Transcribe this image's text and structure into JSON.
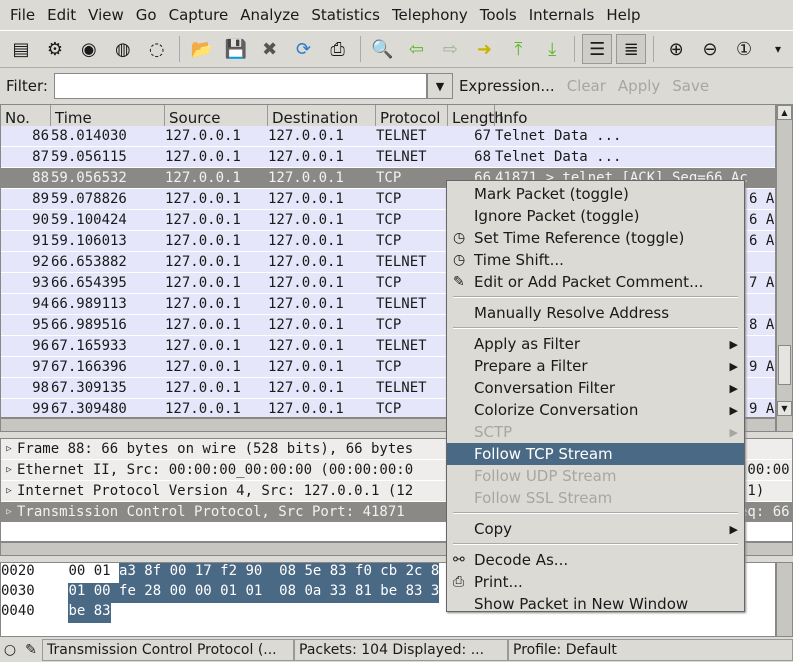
{
  "menubar": [
    "File",
    "Edit",
    "View",
    "Go",
    "Capture",
    "Analyze",
    "Statistics",
    "Telephony",
    "Tools",
    "Internals",
    "Help"
  ],
  "toolbar": [
    "interface-list-icon",
    "capture-options-icon",
    "start-capture-icon",
    "stop-capture-icon",
    "restart-capture-icon",
    "open-icon",
    "save-icon",
    "close-icon",
    "reload-icon",
    "print-icon",
    "find-icon",
    "back-icon",
    "forward-icon",
    "go-to-packet-icon",
    "first-packet-icon",
    "last-packet-icon",
    "colorize-icon",
    "auto-scroll-icon",
    "zoom-in-icon",
    "zoom-out-icon",
    "normal-size-icon",
    "more-icon"
  ],
  "filter": {
    "label": "Filter:",
    "value": "",
    "expression": "Expression...",
    "clear": "Clear",
    "apply": "Apply",
    "save": "Save"
  },
  "columns": [
    "No.",
    "Time",
    "Source",
    "Destination",
    "Protocol",
    "Length",
    "Info"
  ],
  "packets": [
    {
      "no": "86",
      "time": "58.014030",
      "src": "127.0.0.1",
      "dst": "127.0.0.1",
      "proto": "TELNET",
      "len": "67",
      "info": "Telnet Data ..."
    },
    {
      "no": "87",
      "time": "59.056115",
      "src": "127.0.0.1",
      "dst": "127.0.0.1",
      "proto": "TELNET",
      "len": "68",
      "info": "Telnet Data ..."
    },
    {
      "no": "88",
      "time": "59.056532",
      "src": "127.0.0.1",
      "dst": "127.0.0.1",
      "proto": "TCP",
      "len": "66",
      "info": "41871 > telnet [ACK] Seq=66 Ac",
      "selected": true
    },
    {
      "no": "89",
      "time": "59.078826",
      "src": "127.0.0.1",
      "dst": "127.0.0.1",
      "proto": "TCP",
      "tail": "6 Ac"
    },
    {
      "no": "90",
      "time": "59.100424",
      "src": "127.0.0.1",
      "dst": "127.0.0.1",
      "proto": "TCP",
      "tail": "6 Ac"
    },
    {
      "no": "91",
      "time": "59.106013",
      "src": "127.0.0.1",
      "dst": "127.0.0.1",
      "proto": "TCP",
      "tail": "6 Ac"
    },
    {
      "no": "92",
      "time": "66.653882",
      "src": "127.0.0.1",
      "dst": "127.0.0.1",
      "proto": "TELNET",
      "tail": ""
    },
    {
      "no": "93",
      "time": "66.654395",
      "src": "127.0.0.1",
      "dst": "127.0.0.1",
      "proto": "TCP",
      "tail": "7 Ac"
    },
    {
      "no": "94",
      "time": "66.989113",
      "src": "127.0.0.1",
      "dst": "127.0.0.1",
      "proto": "TELNET",
      "tail": ""
    },
    {
      "no": "95",
      "time": "66.989516",
      "src": "127.0.0.1",
      "dst": "127.0.0.1",
      "proto": "TCP",
      "tail": "8 Ac"
    },
    {
      "no": "96",
      "time": "67.165933",
      "src": "127.0.0.1",
      "dst": "127.0.0.1",
      "proto": "TELNET",
      "tail": ""
    },
    {
      "no": "97",
      "time": "67.166396",
      "src": "127.0.0.1",
      "dst": "127.0.0.1",
      "proto": "TCP",
      "tail": "9 Ac"
    },
    {
      "no": "98",
      "time": "67.309135",
      "src": "127.0.0.1",
      "dst": "127.0.0.1",
      "proto": "TELNET",
      "tail": ""
    },
    {
      "no": "99",
      "time": "67.309480",
      "src": "127.0.0.1",
      "dst": "127.0.0.1",
      "proto": "TCP",
      "tail": "9 Ac"
    }
  ],
  "details": [
    {
      "text": "Frame 88: 66 bytes on wire (528 bits), 66 bytes",
      "tail": ""
    },
    {
      "text": "Ethernet II, Src: 00:00:00_00:00:00 (00:00:00:0",
      "tail": "(00:00"
    },
    {
      "text": "Internet Protocol Version 4, Src: 127.0.0.1 (12",
      "tail": ".1)"
    },
    {
      "text": "Transmission Control Protocol, Src Port: 41871",
      "tail": "eq: 66",
      "selected": true
    }
  ],
  "bytes": [
    {
      "offset": "0020",
      "plain": "00 01 ",
      "hl": "a3 8f 00 17 f2 90  08 5e 83 f0 cb 2c 8"
    },
    {
      "offset": "0030",
      "plain": "",
      "hl": "01 00 fe 28 00 00 01 01  08 0a 33 81 be 83 3"
    },
    {
      "offset": "0040",
      "plain": "",
      "hl": "be 83"
    }
  ],
  "status": {
    "field": "Transmission Control Protocol (...",
    "packets": "Packets: 104 Displayed: ...",
    "profile": "Profile: Default"
  },
  "context_menu": [
    {
      "label": "Mark Packet (toggle)"
    },
    {
      "label": "Ignore Packet (toggle)"
    },
    {
      "label": "Set Time Reference (toggle)",
      "icon": "clock-icon"
    },
    {
      "label": "Time Shift...",
      "icon": "clock-icon"
    },
    {
      "label": "Edit or Add Packet Comment...",
      "icon": "comment-icon"
    },
    {
      "sep": true
    },
    {
      "label": "Manually Resolve Address"
    },
    {
      "sep": true
    },
    {
      "label": "Apply as Filter",
      "submenu": true
    },
    {
      "label": "Prepare a Filter",
      "submenu": true
    },
    {
      "label": "Conversation Filter",
      "submenu": true
    },
    {
      "label": "Colorize Conversation",
      "submenu": true
    },
    {
      "label": "SCTP",
      "submenu": true,
      "disabled": true
    },
    {
      "label": "Follow TCP Stream",
      "active": true
    },
    {
      "label": "Follow UDP Stream",
      "disabled": true
    },
    {
      "label": "Follow SSL Stream",
      "disabled": true
    },
    {
      "sep": true
    },
    {
      "label": "Copy",
      "submenu": true
    },
    {
      "sep": true
    },
    {
      "label": "Decode As...",
      "icon": "decode-icon"
    },
    {
      "label": "Print...",
      "icon": "print-icon"
    },
    {
      "label": "Show Packet in New Window"
    }
  ],
  "colors": {
    "selection": "#4a6984",
    "selected_row": "#8a8986",
    "row_bg": "#e6e6fb"
  }
}
